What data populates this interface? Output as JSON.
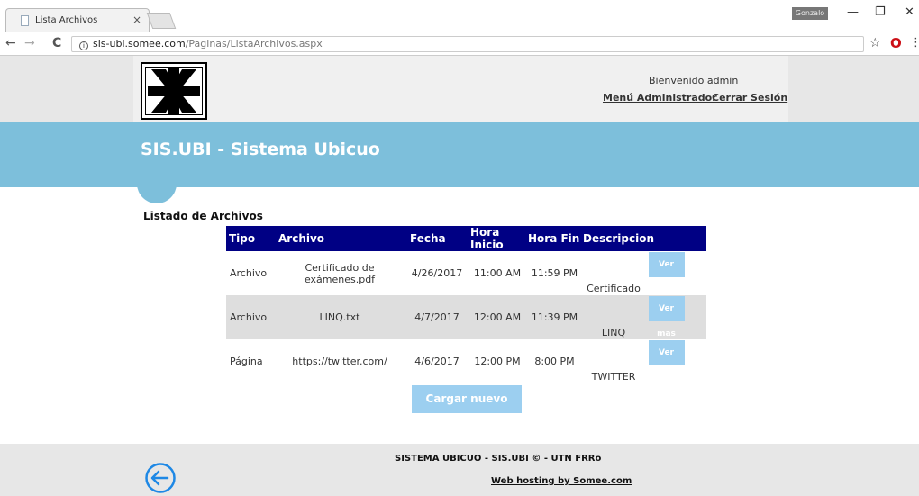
{
  "browser": {
    "tab_title": "Lista Archivos",
    "tab_close": "×",
    "user_badge": "Gonzalo",
    "url_host": "sis-ubi.somee.com",
    "url_path": "/Paginas/ListaArchivos.aspx",
    "window_minimize": "—",
    "window_restore": "❐",
    "window_close": "✕",
    "nav_back": "←",
    "nav_forward": "→",
    "nav_reload": "C",
    "star": "☆",
    "opera": "O",
    "menu": "⋮"
  },
  "header": {
    "welcome": "Bienvenido admin",
    "menu_admin": "Menú Administrador",
    "logout": "Cerrar Sesión"
  },
  "banner": {
    "title": "SIS.UBI - Sistema Ubicuo"
  },
  "main": {
    "list_title": "Listado de Archivos",
    "columns": [
      "Tipo",
      "Archivo",
      "Fecha",
      "Hora Inicio",
      "Hora Fin",
      "Descripcion"
    ],
    "rows": [
      {
        "tipo": "Archivo",
        "archivo": "Certificado de exámenes.pdf",
        "fecha": "4/26/2017",
        "inicio": "11:00 AM",
        "fin": "11:59 PM",
        "descripcion": "Certificado",
        "action": "Ver mas"
      },
      {
        "tipo": "Archivo",
        "archivo": "LINQ.txt",
        "fecha": "4/7/2017",
        "inicio": "12:00 AM",
        "fin": "11:39 PM",
        "descripcion": "LINQ",
        "action": "Ver mas"
      },
      {
        "tipo": "Página",
        "archivo": "https://twitter.com/",
        "fecha": "4/6/2017",
        "inicio": "12:00 PM",
        "fin": "8:00 PM",
        "descripcion": "TWITTER",
        "action": "Ver mas"
      }
    ],
    "upload_button": "Cargar nuevo"
  },
  "footer": {
    "copyright": "SISTEMA UBICUO - SIS.UBI © - UTN FRRo",
    "hosting": "Web hosting by Somee.com"
  },
  "colors": {
    "banner": "#7dbfdb",
    "table_header": "#000084",
    "button": "#9ccff0"
  },
  "icons": {
    "back": "back-arrow-circle-icon",
    "logo": "utn-logo-icon"
  }
}
